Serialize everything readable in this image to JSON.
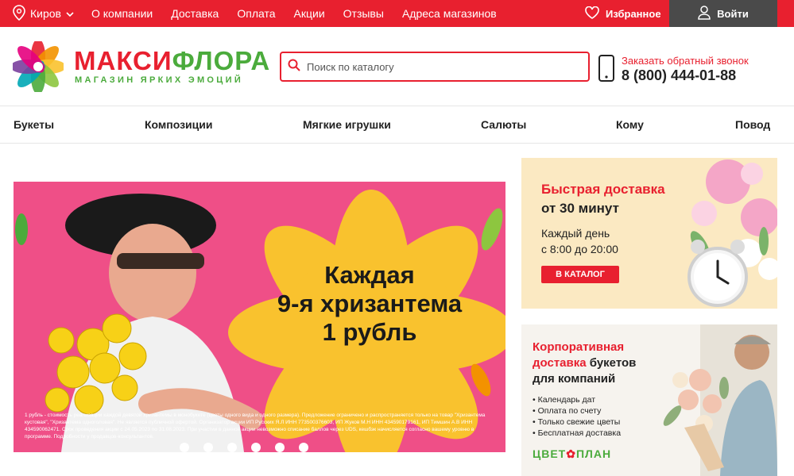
{
  "topbar": {
    "city": "Киров",
    "nav": [
      "О компании",
      "Доставка",
      "Оплата",
      "Акции",
      "Отзывы",
      "Адреса магазинов"
    ],
    "favorites": "Избранное",
    "login": "Войти"
  },
  "header": {
    "logo_part1": "МАКСИ",
    "logo_part2": "ФЛОРА",
    "tagline": "МАГАЗИН ЯРКИХ ЭМОЦИЙ",
    "search_placeholder": "Поиск по каталогу",
    "callback_link": "Заказать обратный звонок",
    "phone": "8 (800) 444-01-88"
  },
  "categories": [
    "Букеты",
    "Композиции",
    "Мягкие игрушки",
    "Салюты",
    "Кому",
    "Повод"
  ],
  "main_banner": {
    "line1": "Каждая",
    "line2": "9-я хризантема",
    "line3": "1 рубль",
    "fine_print": "1 рубль - стоимость реализации каждой девятой хризантемы в монобукете (цветы одного вида и одного размера). Предложение ограничено и распространяется только на товар \"Хризантема кустовая\", \"Хризантема одноголовая\". Не является публичной офертой. Организатор акции ИП Русских Я.Л ИНН 773500376603, ИП Жуков М.Н ИНН 434590179161, ИП Тимшин А.В ИНН 434590062471. Срок проведения акции с 24.05.2023 по 31.08.2023. При участии в данной акции невозможно списание баллов через UDS, кешбэк начисляется согласно вашему уровню в программе. Подробности у продавцов-консультантов.",
    "dots_count": 6
  },
  "promo_delivery": {
    "title": "Быстрая доставка",
    "subtitle": "от 30 минут",
    "line1": "Каждый день",
    "line2": "с 8:00 до 20:00",
    "button": "В КАТАЛОГ"
  },
  "promo_corporate": {
    "title_line1": "Корпоративная",
    "title_line2_red": "доставка",
    "title_line2_black": " букетов",
    "title_line3": "для компаний",
    "items": [
      "Календарь дат",
      "Оплата по счету",
      "Только свежие цветы",
      "Бесплатная доставка"
    ],
    "brand_part1": "ЦВЕТ",
    "brand_part2": "ПЛАН"
  },
  "colors": {
    "brand_red": "#e8202f",
    "brand_green": "#4bab3c",
    "login_bg": "#4a4a4a",
    "banner_pink": "#ef4f87",
    "flower_yellow": "#f9c22e"
  }
}
